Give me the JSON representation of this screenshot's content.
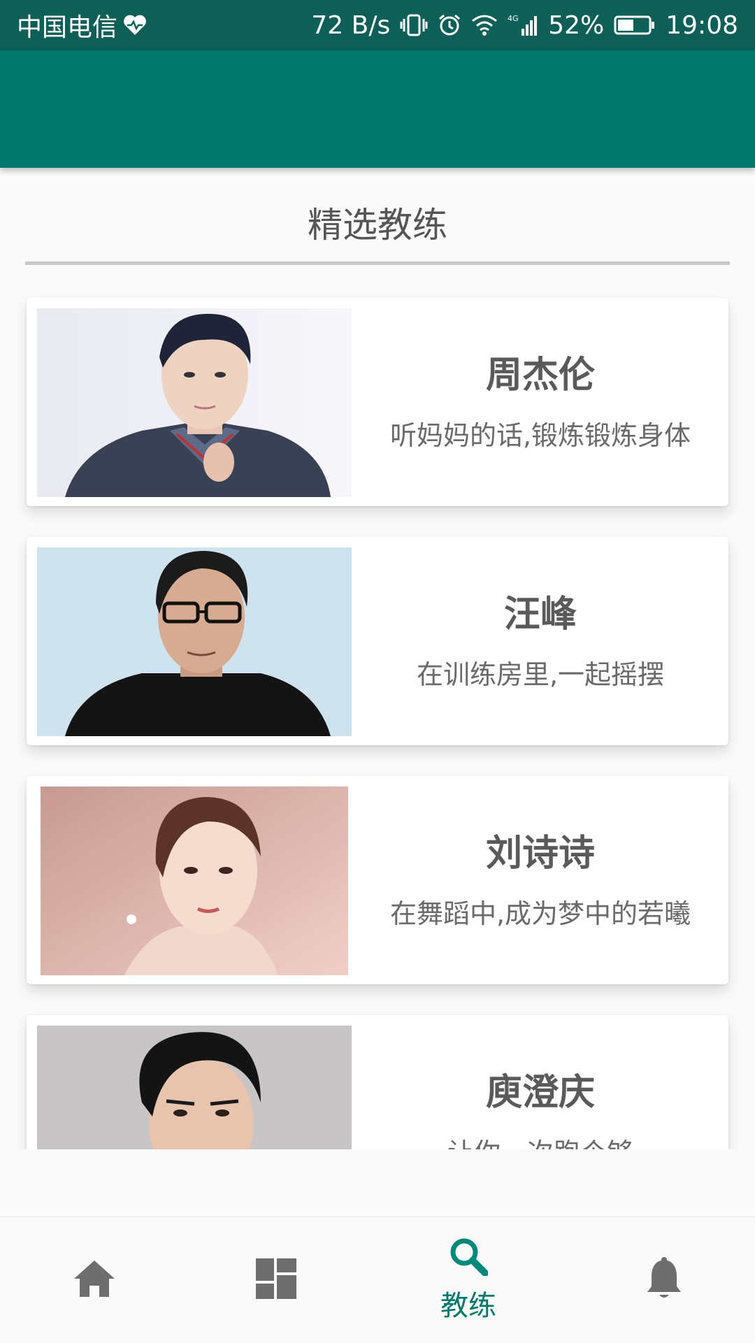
{
  "status_bar": {
    "carrier": "中国电信",
    "speed": "72 B/s",
    "network": "4G",
    "battery": "52%",
    "time": "19:08",
    "icons": [
      "heart-monitor-icon",
      "vibrate-icon",
      "alarm-icon",
      "wifi-icon",
      "signal-icon",
      "battery-icon"
    ]
  },
  "section": {
    "title": "精选教练"
  },
  "coaches": [
    {
      "name": "周杰伦",
      "motto": "听妈妈的话,锻炼锻炼身体"
    },
    {
      "name": "汪峰",
      "motto": "在训练房里,一起摇摆"
    },
    {
      "name": "刘诗诗",
      "motto": "在舞蹈中,成为梦中的若曦"
    },
    {
      "name": "庾澄庆",
      "motto": "让你一次跑个够"
    }
  ],
  "bottom_nav": {
    "items": [
      {
        "icon": "home-icon",
        "label": ""
      },
      {
        "icon": "dashboard-icon",
        "label": ""
      },
      {
        "icon": "search-icon",
        "label": "教练",
        "active": true
      },
      {
        "icon": "bell-icon",
        "label": ""
      }
    ]
  },
  "colors": {
    "status_bar": "#0d5f57",
    "app_bar": "#00796b",
    "accent": "#00897b",
    "inactive_icon": "#6e6e6e"
  }
}
